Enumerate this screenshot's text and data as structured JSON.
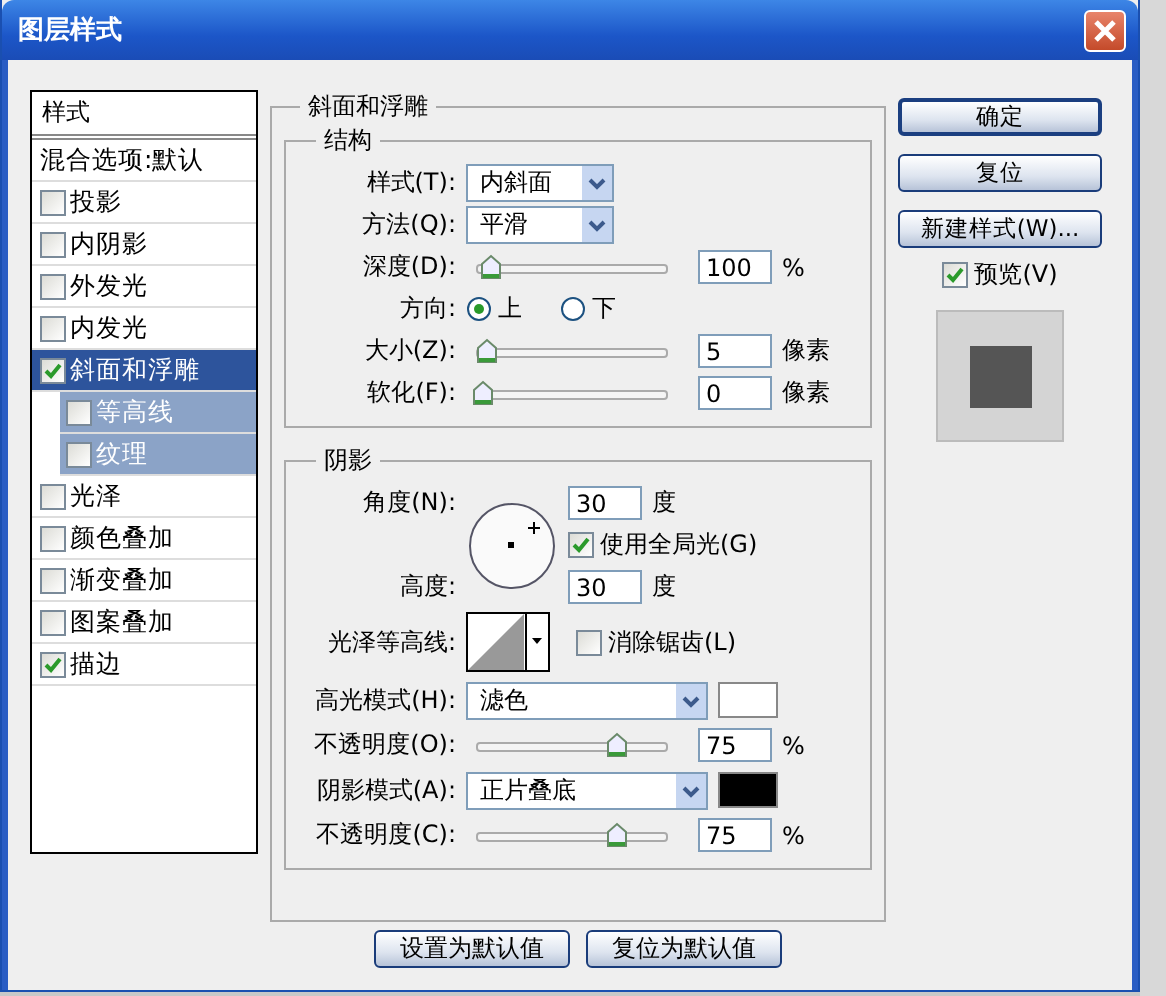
{
  "window": {
    "title": "图层样式"
  },
  "styles_list": {
    "header": "样式",
    "blend_options": "混合选项:默认",
    "items": [
      {
        "label": "投影",
        "checked": false,
        "selected": false
      },
      {
        "label": "内阴影",
        "checked": false,
        "selected": false
      },
      {
        "label": "外发光",
        "checked": false,
        "selected": false
      },
      {
        "label": "内发光",
        "checked": false,
        "selected": false
      },
      {
        "label": "斜面和浮雕",
        "checked": true,
        "selected": true,
        "children": [
          {
            "label": "等高线",
            "checked": false,
            "selected": false
          },
          {
            "label": "纹理",
            "checked": false,
            "selected": false
          }
        ]
      },
      {
        "label": "光泽",
        "checked": false,
        "selected": false
      },
      {
        "label": "颜色叠加",
        "checked": false,
        "selected": false
      },
      {
        "label": "渐变叠加",
        "checked": false,
        "selected": false
      },
      {
        "label": "图案叠加",
        "checked": false,
        "selected": false
      },
      {
        "label": "描边",
        "checked": true,
        "selected": false
      }
    ]
  },
  "panel": {
    "title": "斜面和浮雕",
    "structure": {
      "title": "结构",
      "rows": [
        {
          "kind": "dropdown",
          "label": "样式(T):",
          "value": "内斜面"
        },
        {
          "kind": "dropdown",
          "label": "方法(Q):",
          "value": "平滑"
        },
        {
          "kind": "slider",
          "label": "深度(D):",
          "level": 0.05,
          "value": "100",
          "unit": "%"
        },
        {
          "kind": "radio",
          "label": "方向:",
          "options": [
            {
              "label": "上",
              "selected": true
            },
            {
              "label": "下",
              "selected": false
            }
          ]
        },
        {
          "kind": "slider",
          "label": "大小(Z):",
          "level": 0.02,
          "value": "5",
          "unit": "像素"
        },
        {
          "kind": "slider",
          "label": "软化(F):",
          "level": 0,
          "value": "0",
          "unit": "像素"
        }
      ]
    },
    "shading": {
      "title": "阴影",
      "angle": {
        "label": "角度(N):",
        "value": "30",
        "unit": "度"
      },
      "global_light": {
        "label": "使用全局光(G)",
        "checked": true
      },
      "altitude": {
        "label": "高度:",
        "value": "30",
        "unit": "度"
      },
      "rows": [
        {
          "kind": "contour",
          "label": "光泽等高线:",
          "anti_alias": {
            "label": "消除锯齿(L)",
            "checked": false
          }
        },
        {
          "kind": "mode",
          "label": "高光模式(H):",
          "value": "滤色",
          "color": "#ffffff"
        },
        {
          "kind": "slider",
          "label": "不透明度(O):",
          "level": 0.75,
          "value": "75",
          "unit": "%"
        },
        {
          "kind": "mode",
          "label": "阴影模式(A):",
          "value": "正片叠底",
          "color": "#000000"
        },
        {
          "kind": "slider",
          "label": "不透明度(C):",
          "level": 0.75,
          "value": "75",
          "unit": "%"
        }
      ]
    },
    "buttons": [
      "设置为默认值",
      "复位为默认值"
    ]
  },
  "actions": {
    "buttons": [
      {
        "label": "确定",
        "default": true
      },
      {
        "label": "复位",
        "default": false
      },
      {
        "label": "新建样式(W)...",
        "default": false
      }
    ],
    "preview": {
      "label": "预览(V)",
      "checked": true
    }
  }
}
